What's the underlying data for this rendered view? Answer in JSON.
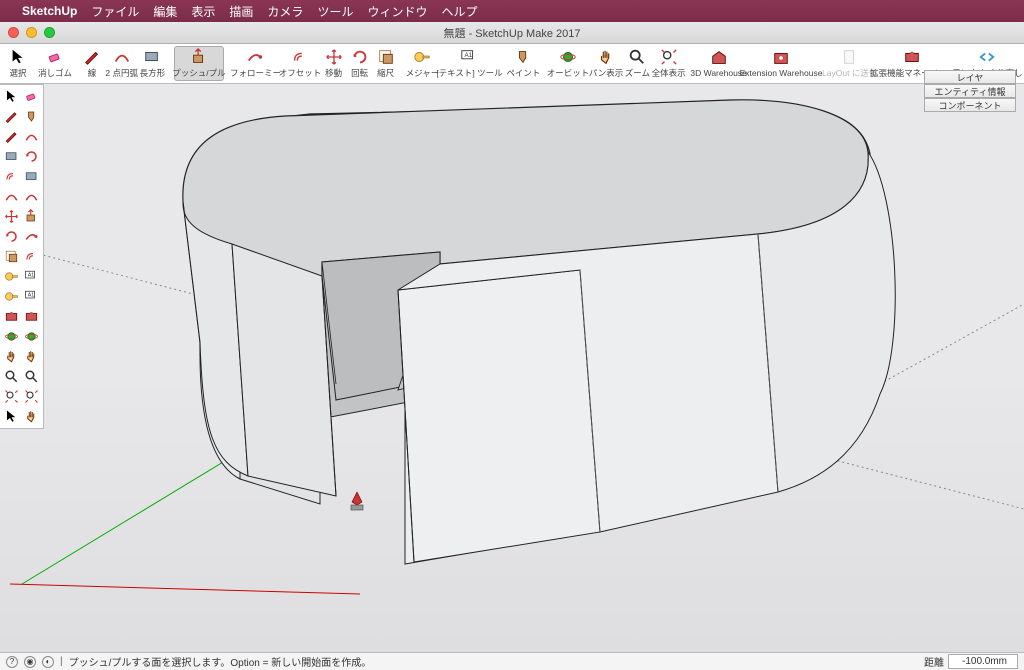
{
  "mac_menu": {
    "app": "SketchUp",
    "items": [
      "ファイル",
      "編集",
      "表示",
      "描画",
      "カメラ",
      "ツール",
      "ウィンドウ",
      "ヘルプ"
    ]
  },
  "window_title": "無題 - SketchUp Make 2017",
  "main_toolbar": [
    {
      "name": "select",
      "label": "選択",
      "icon": "cursor"
    },
    {
      "name": "eraser",
      "label": "消しゴム",
      "icon": "eraser"
    },
    {
      "name": "line",
      "label": "線",
      "icon": "pencil"
    },
    {
      "name": "arc",
      "label": "2 点円弧",
      "icon": "arc"
    },
    {
      "name": "rectangle",
      "label": "長方形",
      "icon": "rect"
    },
    {
      "name": "pushpull",
      "label": "プッシュ/プル",
      "icon": "pushpull",
      "active": true
    },
    {
      "name": "followme",
      "label": "フォローミー",
      "icon": "followme"
    },
    {
      "name": "offset",
      "label": "オフセット",
      "icon": "offset"
    },
    {
      "name": "move",
      "label": "移動",
      "icon": "move"
    },
    {
      "name": "rotate",
      "label": "回転",
      "icon": "rotate"
    },
    {
      "name": "scale",
      "label": "縮尺",
      "icon": "scale"
    },
    {
      "name": "tape",
      "label": "メジャー",
      "icon": "tape"
    },
    {
      "name": "text",
      "label": "[テキスト] ツール",
      "icon": "text"
    },
    {
      "name": "paint",
      "label": "ペイント",
      "icon": "paint"
    },
    {
      "name": "orbit",
      "label": "オービット",
      "icon": "orbit"
    },
    {
      "name": "pan",
      "label": "パン表示",
      "icon": "pan"
    },
    {
      "name": "zoom",
      "label": "ズーム",
      "icon": "zoom"
    },
    {
      "name": "zoomext",
      "label": "全体表示",
      "icon": "zoomext"
    },
    {
      "name": "3dwh",
      "label": "3D Warehouse",
      "icon": "3dwh"
    },
    {
      "name": "extwh",
      "label": "Extension Warehouse",
      "icon": "extwh"
    },
    {
      "name": "layout",
      "label": "LayOut に送信",
      "icon": "layout",
      "disabled": true
    },
    {
      "name": "extmgr",
      "label": "拡張機能マネージャー",
      "icon": "extmgr"
    },
    {
      "name": "undo",
      "label": "元に戻す/やり直し",
      "icon": "undo"
    }
  ],
  "right_panels": [
    "レイヤ",
    "エンティティ情報",
    "コンポーネント"
  ],
  "status": {
    "hint": "プッシュ/プルする面を選択します。Option = 新しい開始面を作成。",
    "dist_label": "距離",
    "dist_value": "-100.0mm"
  }
}
